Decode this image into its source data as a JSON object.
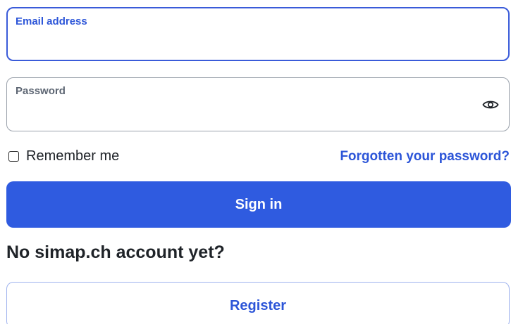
{
  "email_field": {
    "label": "Email address",
    "value": ""
  },
  "password_field": {
    "label": "Password",
    "value": "",
    "visibility_icon": "eye-icon"
  },
  "remember_me": {
    "label": "Remember me",
    "checked": false
  },
  "forgot_link": "Forgotten your password?",
  "sign_in_button": "Sign in",
  "no_account_heading": "No simap.ch account yet?",
  "register_button": "Register",
  "colors": {
    "accent": "#2f5be0",
    "link": "#2c55d8",
    "text": "#1f2328"
  }
}
